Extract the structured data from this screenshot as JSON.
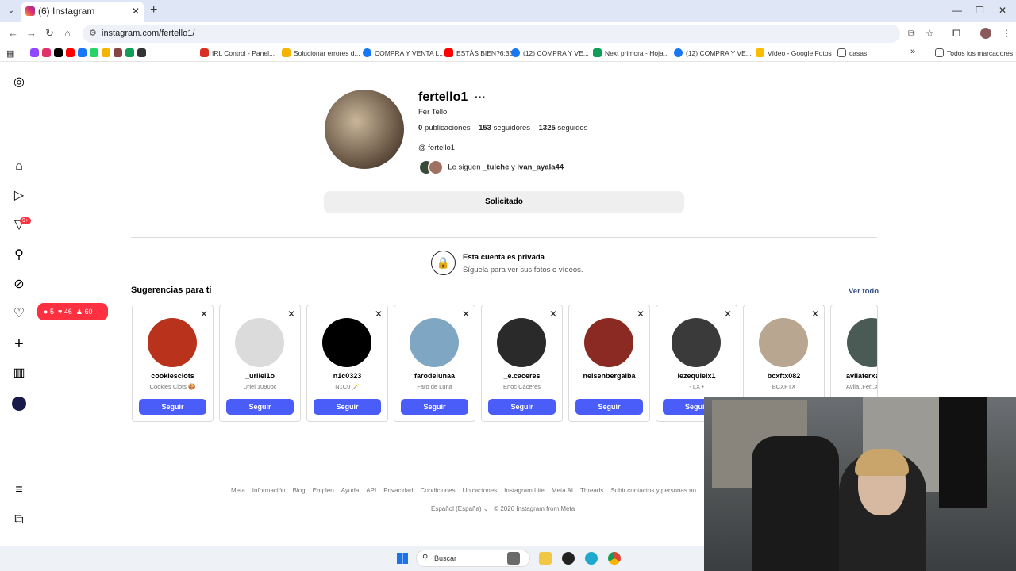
{
  "browser": {
    "tab_title": "(6) Instagram",
    "url": "instagram.com/fertello1/",
    "bookmarks": [
      {
        "label": "IRL Control - Panel...",
        "color": "#d93025"
      },
      {
        "label": "Solucionar errores d...",
        "color": "#f4b400"
      },
      {
        "label": "COMPRA Y VENTA L...",
        "color": "#1877f2"
      },
      {
        "label": "ESTÁS BIEN?6:33",
        "color": "#ff0000"
      },
      {
        "label": "(12) COMPRA Y VE...",
        "color": "#1877f2"
      },
      {
        "label": "Next primora - Hoja...",
        "color": "#0f9d58"
      },
      {
        "label": "(12) COMPRA Y VE...",
        "color": "#1877f2"
      },
      {
        "label": "Vídeo - Google Fotos",
        "color": "#fbbc04"
      },
      {
        "label": "casas",
        "color": "#555555"
      }
    ],
    "all_bookmarks": "Todos los marcadores"
  },
  "sidebar": {
    "badge": "9+",
    "notif_comments": "5",
    "notif_likes": "46",
    "notif_follows": "60"
  },
  "profile": {
    "username": "fertello1",
    "full_name": "Fer Tello",
    "posts_count": "0",
    "posts_label": "publicaciones",
    "followers_count": "153",
    "followers_label": "seguidores",
    "following_count": "1325",
    "following_label": "seguidos",
    "threads_handle": "fertello1",
    "followed_by_prefix": "Le siguen",
    "followed_by_1": "_tulche",
    "followed_by_and": "y",
    "followed_by_2": "ivan_ayala44",
    "requested_button": "Solicitado",
    "private_title": "Esta cuenta es privada",
    "private_subtitle": "Síguela para ver sus fotos o vídeos."
  },
  "suggestions": {
    "title": "Sugerencias para ti",
    "see_all": "Ver todo",
    "follow_label": "Seguir",
    "items": [
      {
        "username": "cookiesclots",
        "name": "Cookies Clots 🍪",
        "color": "#b8321c"
      },
      {
        "username": "_uriiel1o",
        "name": "Uriel 1090bc",
        "color": "#dbdbdb"
      },
      {
        "username": "n1c0323",
        "name": "N1C0 🪄",
        "color": "#000000"
      },
      {
        "username": "farodelunaa",
        "name": "Faro de Luna",
        "color": "#7fa6c2"
      },
      {
        "username": "_e.caceres",
        "name": "Enoc Cáceres",
        "color": "#2a2a2a"
      },
      {
        "username": "neisenbergalba",
        "name": "",
        "color": "#8a2a22"
      },
      {
        "username": "lezequielx1",
        "name": "- LX •",
        "color": "#3a3a3a"
      },
      {
        "username": "bcxftx082",
        "name": "BCXFTX",
        "color": "#b8a690"
      },
      {
        "username": "avilaferxe",
        "name": "Avila..Fer..X",
        "color": "#4a5a55"
      }
    ]
  },
  "footer": {
    "links": [
      "Meta",
      "Información",
      "Blog",
      "Empleo",
      "Ayuda",
      "API",
      "Privacidad",
      "Condiciones",
      "Ubicaciones",
      "Instagram Lite",
      "Meta AI",
      "Threads",
      "Subir contactos y personas no"
    ],
    "language": "Español (España)",
    "copyright": "© 2026 Instagram from Meta"
  },
  "taskbar": {
    "search_placeholder": "Buscar"
  }
}
